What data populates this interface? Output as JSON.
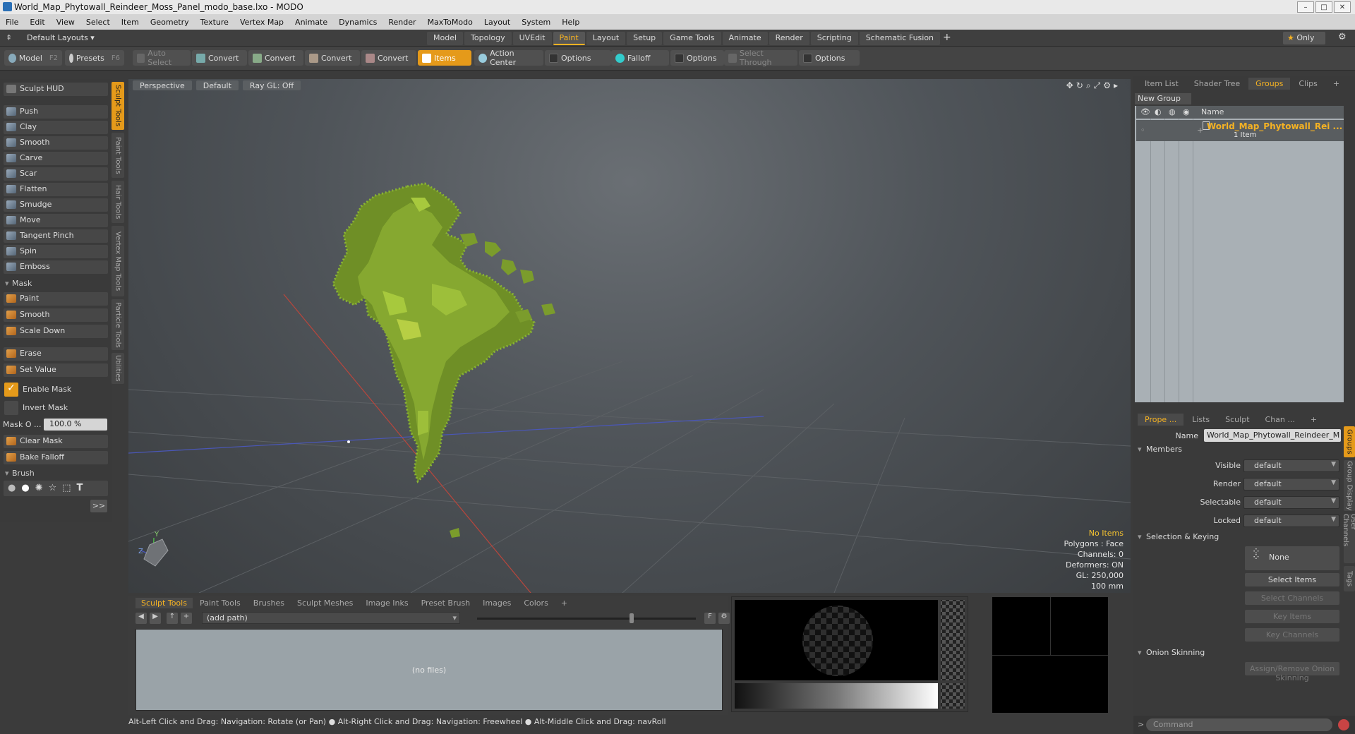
{
  "window": {
    "title": "World_Map_Phytowall_Reindeer_Moss_Panel_modo_base.lxo - MODO",
    "controls": [
      "–",
      "□",
      "✕"
    ]
  },
  "menu": [
    "File",
    "Edit",
    "View",
    "Select",
    "Item",
    "Geometry",
    "Texture",
    "Vertex Map",
    "Animate",
    "Dynamics",
    "Render",
    "MaxToModo",
    "Layout",
    "System",
    "Help"
  ],
  "layoutbar": {
    "layouts_label": "Default Layouts ▾",
    "tabs": [
      "Model",
      "Topology",
      "UVEdit",
      "Paint",
      "Layout",
      "Setup",
      "Game Tools",
      "Animate",
      "Render",
      "Scripting",
      "Schematic Fusion"
    ],
    "active_tab": "Paint",
    "add": "+",
    "only_label": "Only"
  },
  "toolbar": {
    "model": "Model",
    "model_key": "F2",
    "presets": "Presets",
    "presets_key": "F6",
    "auto_select": "Auto Select",
    "convert1": "Convert",
    "convert2": "Convert",
    "convert3": "Convert",
    "convert4": "Convert",
    "items": "Items",
    "action_center": "Action Center",
    "options1": "Options",
    "falloff": "Falloff",
    "options2": "Options",
    "select_through": "Select Through",
    "options3": "Options"
  },
  "left": {
    "hud": "Sculpt HUD",
    "tools": [
      "Push",
      "Clay",
      "Smooth",
      "Carve",
      "Scar",
      "Flatten",
      "Smudge",
      "Move",
      "Tangent Pinch",
      "Spin",
      "Emboss"
    ],
    "mask_section": "Mask",
    "mask_tools": [
      "Paint",
      "Smooth",
      "Scale Down"
    ],
    "erase": "Erase",
    "set_value": "Set Value",
    "enable_mask": "Enable Mask",
    "invert_mask": "Invert Mask",
    "mask_opacity_label": "Mask O ...",
    "mask_opacity_value": "100.0 %",
    "clear_mask": "Clear Mask",
    "bake_falloff": "Bake Falloff",
    "brush_section": "Brush",
    "more": ">>",
    "vertical_tabs": [
      "Sculpt Tools",
      "Paint Tools",
      "Hair Tools",
      "Vertex Map Tools",
      "Particle Tools",
      "Utilities"
    ]
  },
  "viewport": {
    "view": "Perspective",
    "shading": "Default",
    "raygl": "Ray GL: Off",
    "info": {
      "items": "No Items",
      "polygons": "Polygons : Face",
      "channels": "Channels: 0",
      "deformers": "Deformers: ON",
      "gl": "GL: 250,000",
      "scale": "100 mm"
    },
    "axis_y": "Y",
    "axis_z": "Z"
  },
  "browser": {
    "tabs": [
      "Sculpt Tools",
      "Paint Tools",
      "Brushes",
      "Sculpt Meshes",
      "Image Inks",
      "Preset Brush",
      "Images",
      "Colors",
      "+"
    ],
    "path": "(add path)",
    "empty": "(no files)",
    "f_btn": "F"
  },
  "status": "Alt-Left Click and Drag: Navigation: Rotate (or Pan) ● Alt-Right Click and Drag: Navigation: Freewheel ● Alt-Middle Click and Drag: navRoll",
  "right": {
    "top_tabs": [
      "Item List",
      "Shader Tree",
      "Groups",
      "Clips",
      "+"
    ],
    "active_top": "Groups",
    "new_group": "New Group",
    "col_name": "Name",
    "group_name": "World_Map_Phytowall_Rei ...",
    "group_count": "1 Item",
    "prop_tabs": [
      "Prope ...",
      "Lists",
      "Sculpt",
      "Chan ...",
      "+"
    ],
    "name_label": "Name",
    "name_value": "World_Map_Phytowall_Reindeer_M",
    "members": "Members",
    "visible_label": "Visible",
    "visible_value": "default",
    "render_label": "Render",
    "render_value": "default",
    "selectable_label": "Selectable",
    "selectable_value": "default",
    "locked_label": "Locked",
    "locked_value": "default",
    "selkey": "Selection & Keying",
    "none": "None",
    "select_items": "Select Items",
    "select_channels": "Select Channels",
    "key_items": "Key Items",
    "key_channels": "Key Channels",
    "onion": "Onion Skinning",
    "assign_onion": "Assign/Remove Onion Skinning",
    "side_tabs": [
      "Groups",
      "Group Display",
      "User Channels",
      "Tags"
    ],
    "command_placeholder": "Command"
  }
}
